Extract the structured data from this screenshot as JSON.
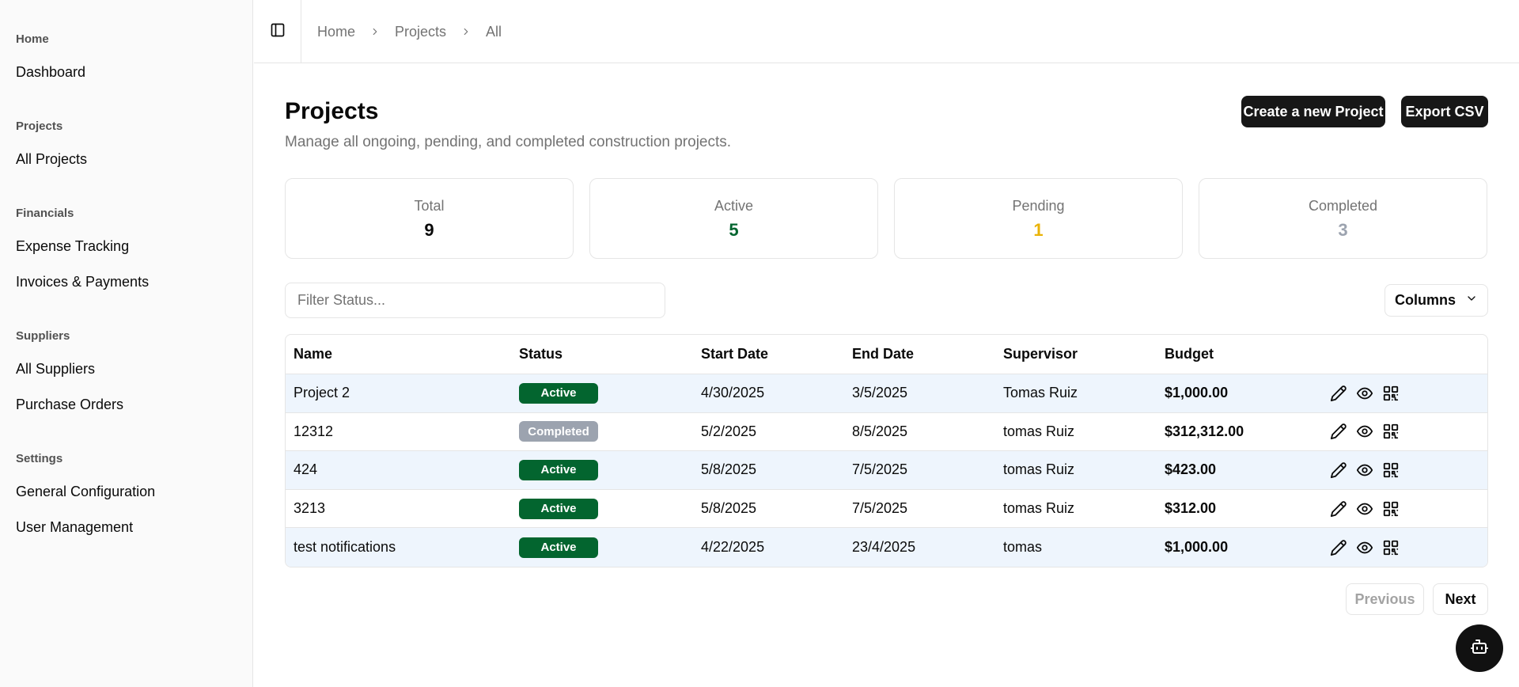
{
  "sidebar": {
    "groups": [
      {
        "label": "Home",
        "items": [
          {
            "label": "Dashboard"
          }
        ]
      },
      {
        "label": "Projects",
        "items": [
          {
            "label": "All Projects"
          }
        ]
      },
      {
        "label": "Financials",
        "items": [
          {
            "label": "Expense Tracking"
          },
          {
            "label": "Invoices & Payments"
          }
        ]
      },
      {
        "label": "Suppliers",
        "items": [
          {
            "label": "All Suppliers"
          },
          {
            "label": "Purchase Orders"
          }
        ]
      },
      {
        "label": "Settings",
        "items": [
          {
            "label": "General Configuration"
          },
          {
            "label": "User Management"
          }
        ]
      }
    ]
  },
  "breadcrumb": [
    "Home",
    "Projects",
    "All"
  ],
  "page": {
    "title": "Projects",
    "subtitle": "Manage all ongoing, pending, and completed construction projects.",
    "create_label": "Create a new Project",
    "export_label": "Export CSV"
  },
  "stats": [
    {
      "label": "Total",
      "value": "9",
      "color": "#0a0a0a"
    },
    {
      "label": "Active",
      "value": "5",
      "color": "#03652f"
    },
    {
      "label": "Pending",
      "value": "1",
      "color": "#eab308"
    },
    {
      "label": "Completed",
      "value": "3",
      "color": "#9ca3af"
    }
  ],
  "filter": {
    "placeholder": "Filter Status...",
    "value": ""
  },
  "columns_label": "Columns",
  "table": {
    "headers": [
      "Name",
      "Status",
      "Start Date",
      "End Date",
      "Supervisor",
      "Budget"
    ],
    "rows": [
      {
        "name": "Project 2",
        "status": "Active",
        "start": "4/30/2025",
        "end": "3/5/2025",
        "supervisor": "Tomas Ruiz",
        "budget": "$1,000.00"
      },
      {
        "name": "12312",
        "status": "Completed",
        "start": "5/2/2025",
        "end": "8/5/2025",
        "supervisor": "tomas Ruiz",
        "budget": "$312,312.00"
      },
      {
        "name": "424",
        "status": "Active",
        "start": "5/8/2025",
        "end": "7/5/2025",
        "supervisor": "tomas Ruiz",
        "budget": "$423.00"
      },
      {
        "name": "3213",
        "status": "Active",
        "start": "5/8/2025",
        "end": "7/5/2025",
        "supervisor": "tomas Ruiz",
        "budget": "$312.00"
      },
      {
        "name": "test notifications",
        "status": "Active",
        "start": "4/22/2025",
        "end": "23/4/2025",
        "supervisor": "tomas",
        "budget": "$1,000.00"
      }
    ],
    "row_actions": [
      "edit-icon",
      "view-icon",
      "qr-code-icon"
    ]
  },
  "status_colors": {
    "Active": "#03652f",
    "Completed": "#9ca3af"
  },
  "pagination": {
    "previous_label": "Previous",
    "next_label": "Next"
  },
  "fab_icon": "bot-icon"
}
